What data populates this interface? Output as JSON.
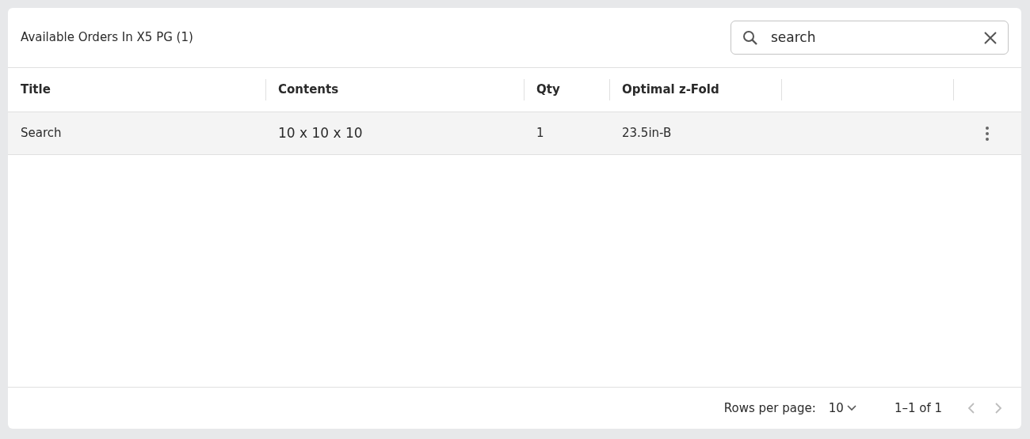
{
  "panel": {
    "title": "Available Orders In X5 PG (1)"
  },
  "search": {
    "value": "search"
  },
  "table": {
    "columns": [
      "Title",
      "Contents",
      "Qty",
      "Optimal z-Fold"
    ],
    "rows": [
      {
        "cells": [
          "Search",
          "10 x 10 x 10",
          "1",
          "23.5in-B"
        ]
      }
    ]
  },
  "pagination": {
    "rows_per_page_label": "Rows per page:",
    "rows_per_page": "10",
    "range": "1–1 of 1",
    "prev_disabled": true,
    "next_disabled": true
  }
}
